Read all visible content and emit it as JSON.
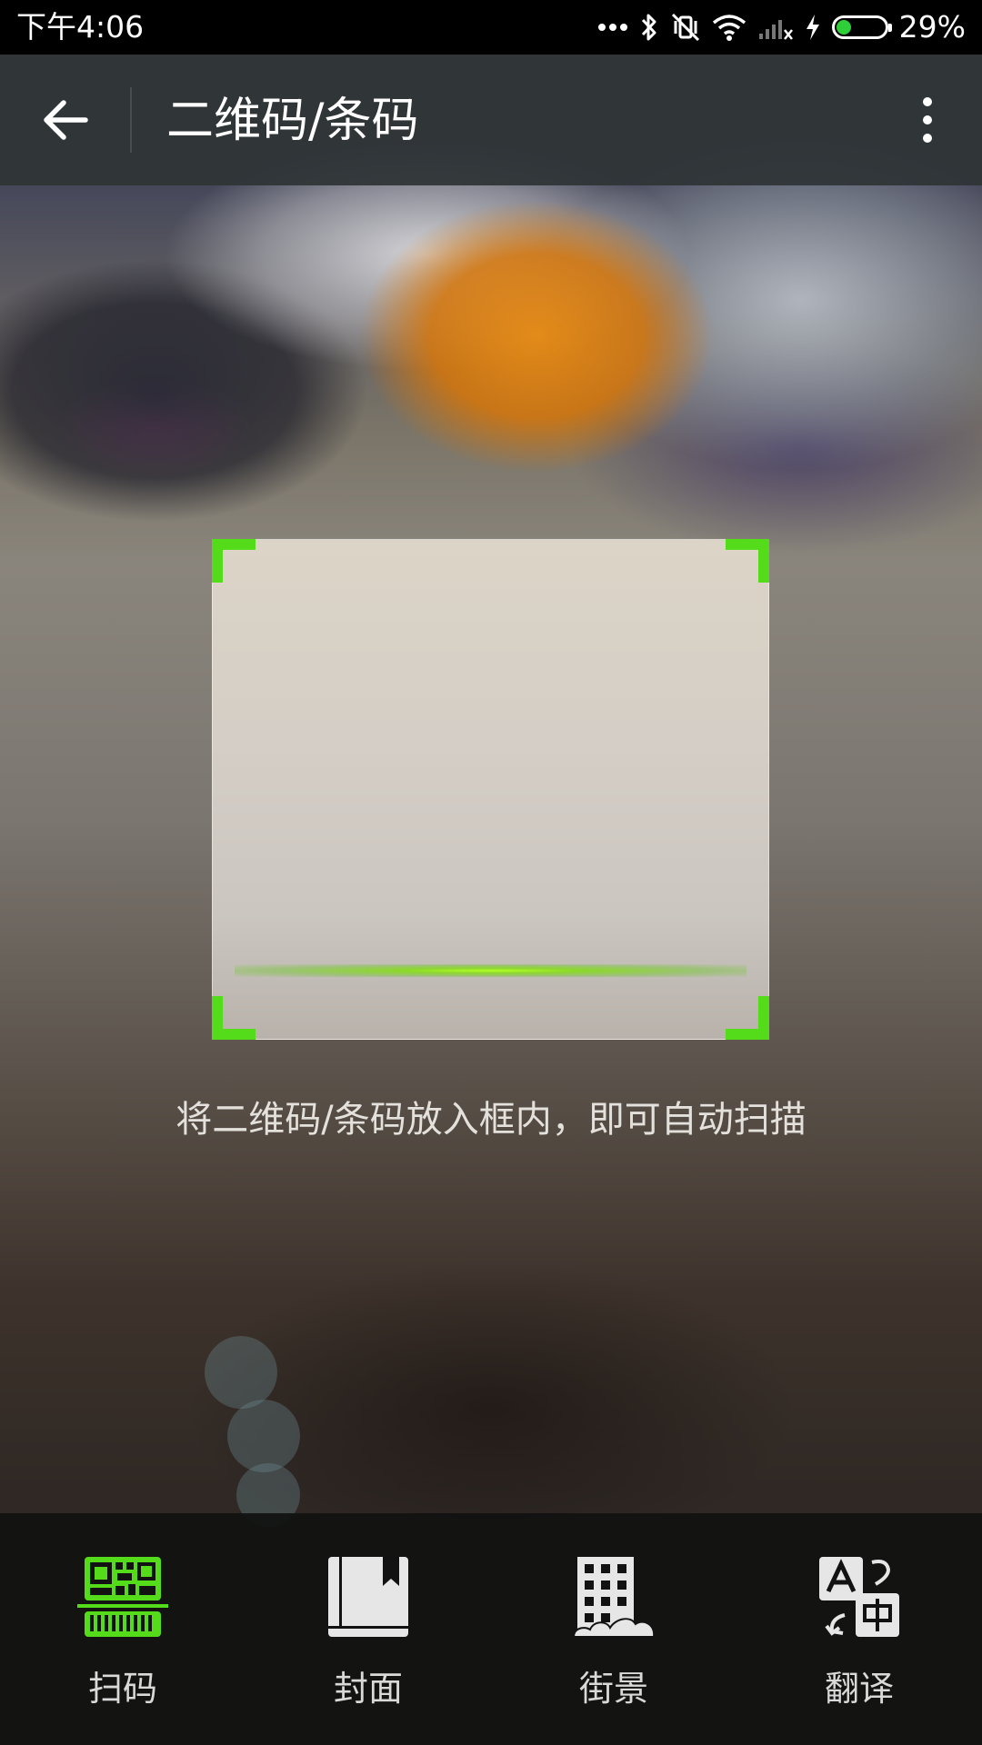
{
  "status_bar": {
    "time": "下午4:06",
    "battery_percent": "29%",
    "battery_level": 0.29,
    "icons": [
      "more-dots-icon",
      "bluetooth-icon",
      "vibrate-off-icon",
      "wifi-icon",
      "cell-signal-no-service-icon",
      "charging-bolt-icon",
      "battery-icon"
    ]
  },
  "app_bar": {
    "title": "二维码/条码",
    "back_icon": "arrow-back-icon",
    "more_icon": "more-vertical-icon"
  },
  "scanner": {
    "hint": "将二维码/条码放入框内，即可自动扫描",
    "accent_color": "#54dc1b"
  },
  "tabs": [
    {
      "label": "扫码",
      "icon": "qr-barcode-icon",
      "active": true
    },
    {
      "label": "封面",
      "icon": "book-cover-icon",
      "active": false
    },
    {
      "label": "街景",
      "icon": "street-view-building-icon",
      "active": false
    },
    {
      "label": "翻译",
      "icon": "translate-icon",
      "active": false
    }
  ],
  "colors": {
    "active_tab": "#54dc1b",
    "inactive_icon": "#e6e6e6",
    "tab_bar_bg": "#121212"
  }
}
